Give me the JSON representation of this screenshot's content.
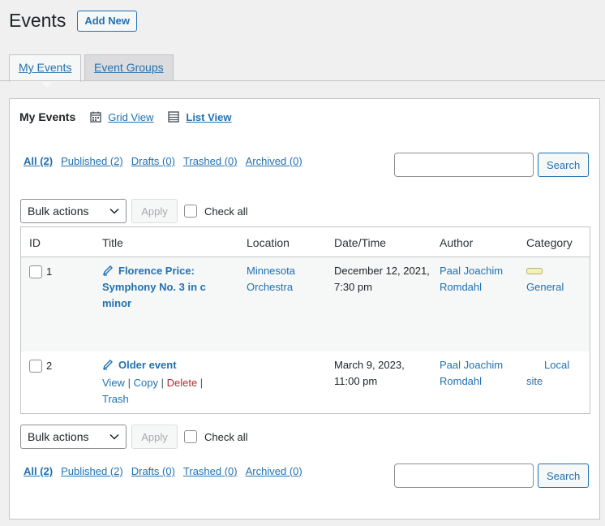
{
  "header": {
    "title": "Events",
    "add_new": "Add New"
  },
  "tabs": [
    {
      "label": "My Events",
      "active": true
    },
    {
      "label": "Event Groups",
      "active": false
    }
  ],
  "views": {
    "title": "My Events",
    "grid": "Grid View",
    "list": "List View",
    "current": "List View"
  },
  "filters": [
    {
      "label": "All (2)",
      "current": true
    },
    {
      "label": "Published (2)",
      "current": false
    },
    {
      "label": "Drafts (0)",
      "current": false
    },
    {
      "label": "Trashed (0)",
      "current": false
    },
    {
      "label": "Archived (0)",
      "current": false
    }
  ],
  "search": {
    "button": "Search",
    "value": ""
  },
  "bulk": {
    "select": "Bulk actions",
    "apply": "Apply",
    "check_all": "Check all"
  },
  "table": {
    "columns": [
      "ID",
      "Title",
      "Location",
      "Date/Time",
      "Author",
      "Category"
    ],
    "rows": [
      {
        "id": "1",
        "title": "Florence Price: Symphony No. 3 in c minor",
        "location": "Minnesota Orchestra",
        "datetime": "December 12, 2021, 7:30 pm",
        "author": "Paal Joachim Romdahl",
        "category": "General",
        "category_color": "#f5f0b3"
      },
      {
        "id": "2",
        "title": "Older event",
        "location": "",
        "datetime": "March 9, 2023, 11:00 pm",
        "author": "Paal Joachim Romdahl",
        "category": "Local site",
        "actions": {
          "view": "View",
          "copy": "Copy",
          "delete": "Delete",
          "trash": "Trash",
          "sep": "|"
        }
      }
    ]
  },
  "colors": {
    "link": "#2271b1",
    "delete": "#b32d2e",
    "background": "#f0f0f1"
  }
}
